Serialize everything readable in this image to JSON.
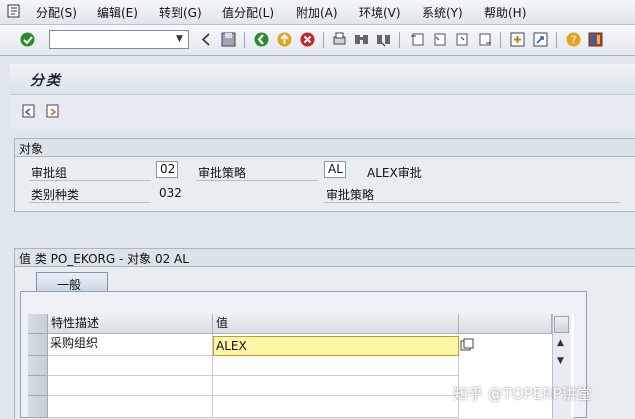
{
  "menu": {
    "items": [
      "分配(S)",
      "编辑(E)",
      "转到(G)",
      "值分配(L)",
      "附加(A)",
      "环境(V)",
      "系统(Y)",
      "帮助(H)"
    ]
  },
  "toolbar": {
    "command_value": "",
    "icons": [
      "enter-icon",
      "command-field",
      "back-icon",
      "save-icon",
      "back-green-icon",
      "exit-icon",
      "cancel-icon",
      "print-icon",
      "find-icon",
      "find-next-icon",
      "first-page-icon",
      "prev-page-icon",
      "next-page-icon",
      "last-page-icon",
      "new-session-icon",
      "shortcut-icon",
      "help-icon",
      "layout-icon"
    ]
  },
  "screen": {
    "title": "分类"
  },
  "object_group": {
    "header": "对象",
    "approval_group_label": "审批组",
    "approval_group_value": "02",
    "strategy_label": "审批策略",
    "strategy_value": "AL",
    "strategy_desc": "ALEX审批",
    "class_type_label": "类别种类",
    "class_type_value": "032",
    "strategy_label2": "审批策略"
  },
  "value_group": {
    "header": "值 类 PO_EKORG - 对象 02 AL",
    "tab_general": "一般",
    "columns": [
      "特性描述",
      "值"
    ],
    "rows": [
      {
        "char": "采购组织",
        "value": "ALEX"
      }
    ]
  },
  "watermark": "知乎 @TOPERP讲堂",
  "colors": {
    "background": "#dfe6ee",
    "highlight": "#fff6a8"
  }
}
